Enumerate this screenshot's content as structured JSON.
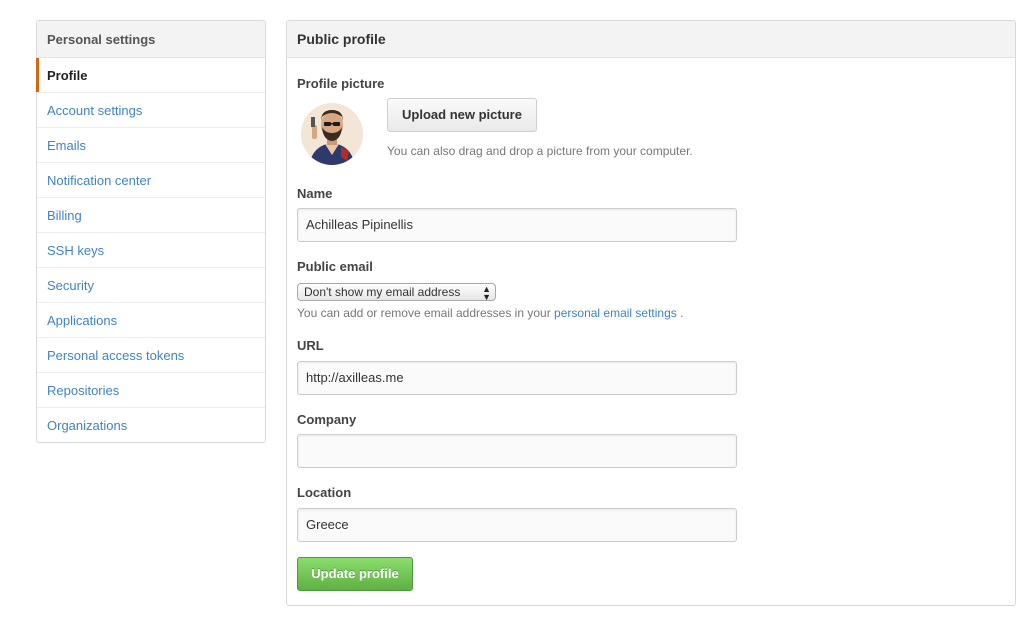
{
  "sidebar": {
    "title": "Personal settings",
    "items": [
      {
        "label": "Profile",
        "selected": true
      },
      {
        "label": "Account settings"
      },
      {
        "label": "Emails"
      },
      {
        "label": "Notification center"
      },
      {
        "label": "Billing"
      },
      {
        "label": "SSH keys"
      },
      {
        "label": "Security"
      },
      {
        "label": "Applications"
      },
      {
        "label": "Personal access tokens"
      },
      {
        "label": "Repositories"
      },
      {
        "label": "Organizations"
      }
    ]
  },
  "profile": {
    "title": "Public profile",
    "picture": {
      "label": "Profile picture",
      "upload_button": "Upload new picture",
      "hint": "You can also drag and drop a picture from your computer."
    },
    "name": {
      "label": "Name",
      "value": "Achilleas Pipinellis"
    },
    "public_email": {
      "label": "Public email",
      "selected": "Don't show my email address",
      "hint_before": "You can add or remove email addresses in your",
      "hint_link": "personal email settings",
      "hint_after": "."
    },
    "url": {
      "label": "URL",
      "value": "http://axilleas.me"
    },
    "company": {
      "label": "Company",
      "value": ""
    },
    "location": {
      "label": "Location",
      "value": "Greece"
    },
    "update_button": "Update profile"
  },
  "colors": {
    "link": "#4183c4",
    "selected_marker": "#d26911",
    "update_button": "#60b044"
  }
}
